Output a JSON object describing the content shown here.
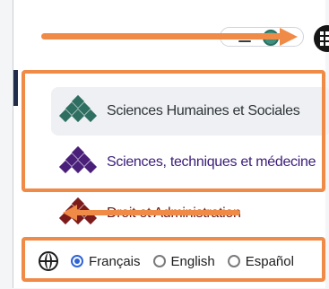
{
  "header": {
    "menu_icon": "hamburger-icon",
    "toggle_icon": "toggle-icon",
    "apps_icon": "grid-icon"
  },
  "menu": {
    "items": [
      {
        "label": "Sciences Humaines et Sociales",
        "color": "#2f6f61"
      },
      {
        "label": "Sciences, techniques et médecine",
        "color": "#4a1f7a"
      },
      {
        "label": "Droit et Administration",
        "color": "#7d1b1b"
      }
    ]
  },
  "languages": {
    "icon": "globe-icon",
    "options": [
      {
        "label": "Français",
        "selected": true
      },
      {
        "label": "English",
        "selected": false
      },
      {
        "label": "Español",
        "selected": false
      }
    ]
  },
  "annotations": {
    "arrow_color": "#f08a47"
  }
}
